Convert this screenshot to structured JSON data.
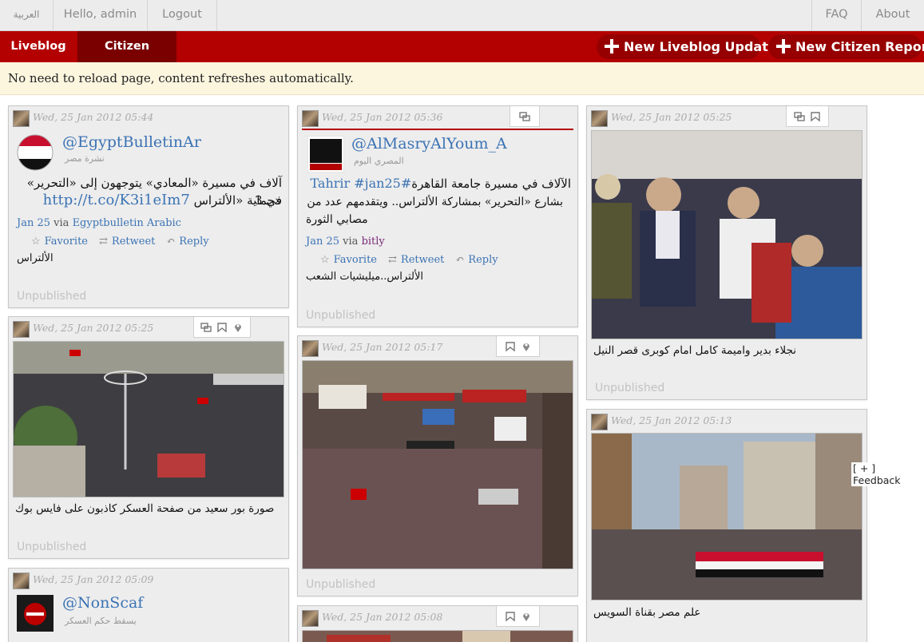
{
  "topbar": {
    "language": "العربية",
    "greeting": "Hello, admin",
    "logout": "Logout",
    "faq": "FAQ",
    "about": "About"
  },
  "nav": {
    "tabs": [
      "Liveblog",
      "Citizen Reports"
    ],
    "active_tab": "Citizen Reports",
    "new_liveblog": "New Liveblog Update",
    "new_citizen_report": "New Citizen Report"
  },
  "notice": "No need to reload page, content refreshes automatically.",
  "colors": {
    "brand_red": "#b30000",
    "dark_red": "#7a0000",
    "link_blue": "#3b73b4",
    "notice_bg": "#fcf6df"
  },
  "status_label": "Unpublished",
  "cards": [
    {
      "date": "Wed, 25 Jan 2012 05:44",
      "type": "tweet",
      "handle": "@EgyptBulletinAr",
      "subname": "نشرة مصر",
      "text": "آلاف في مسيرة «المعادي» يتوجهون إلى «التحرير» في 3",
      "text2": "«حماية «الألتراس",
      "link": "http://t.co/K3i1eIm7",
      "meta_date": "Jan 25",
      "meta_via": "via",
      "meta_source": "Egyptbulletin Arabic",
      "actions": [
        "Favorite",
        "Retweet",
        "Reply"
      ],
      "note": "الألتراس"
    },
    {
      "date": "Wed, 25 Jan 2012 05:36",
      "type": "tweet",
      "handle": "@AlMasryAlYoum_A",
      "subname": "المصري اليوم",
      "hashtags": "#Tahrir #jan25",
      "text": "الآلاف في مسيرة جامعة القاهرة",
      "text2": "بشارع «التحرير» بمشاركة الألتراس.. ويتقدمهم عدد من",
      "text3": "مصابي الثورة",
      "meta_date": "Jan 25",
      "meta_via": "via",
      "meta_source": "bitly",
      "actions": [
        "Favorite",
        "Retweet",
        "Reply"
      ],
      "note": "الألتراس..ميليشيات الشعب",
      "icons": [
        "link-icon"
      ]
    },
    {
      "date": "Wed, 25 Jan 2012 05:25",
      "type": "photo",
      "caption": "نجلاء بدير واميمة كامل امام كوبرى قصر النيل",
      "icons": [
        "link-icon",
        "bookmark-icon"
      ]
    },
    {
      "date": "Wed, 25 Jan 2012 05:25",
      "type": "photo",
      "caption": "صورة بور سعيد من صفحة العسكر كاذبون على فايس بوك",
      "icons": [
        "link-icon",
        "bookmark-icon",
        "location-icon"
      ]
    },
    {
      "date": "Wed, 25 Jan 2012 05:17",
      "type": "photo",
      "icons": [
        "bookmark-icon",
        "location-icon"
      ]
    },
    {
      "date": "Wed, 25 Jan 2012 05:13",
      "type": "photo",
      "caption": "علم مصر بقناة السويس"
    },
    {
      "date": "Wed, 25 Jan 2012 05:09",
      "type": "tweet",
      "handle": "@NonScaf",
      "subname": "يسقط حكم العسكر"
    },
    {
      "date": "Wed, 25 Jan 2012 05:08",
      "type": "photo",
      "icons": [
        "bookmark-icon",
        "location-icon"
      ]
    }
  ],
  "feedback": "[ + ] Feedback"
}
